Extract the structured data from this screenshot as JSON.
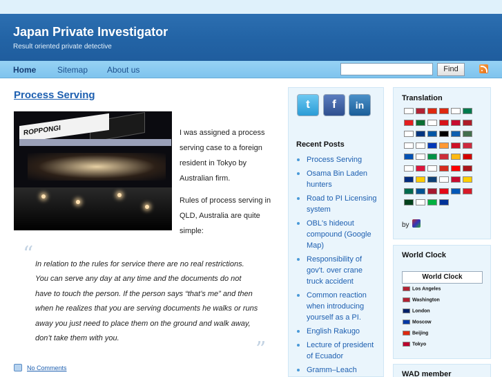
{
  "site": {
    "title": "Japan Private Investigator",
    "tagline": "Result oriented private detective"
  },
  "nav": {
    "items": [
      {
        "label": "Home",
        "active": true
      },
      {
        "label": "Sitemap",
        "active": false
      },
      {
        "label": "About us",
        "active": false
      }
    ],
    "search_placeholder": "",
    "search_button": "Find",
    "rss_icon": "rss-icon"
  },
  "post": {
    "title": "Process Serving",
    "image_sign": "ROPPONGI",
    "paragraphs": [
      "I was assigned a process",
      "serving case to a foreign",
      "resident in Tokyo by",
      "Australian firm.",
      "Rules of process serving in",
      "QLD, Australia are quite",
      "simple:"
    ],
    "quote_open": "“",
    "quote_close": "”",
    "quote_lines": [
      "In relation to the rules for service there are no real restrictions.",
      "You can serve any day at any time and the documents do not",
      "have to touch the person. If the person says “that’s me” and then",
      "when he realizes that you are serving documents he walks or runs",
      "away you just need to place them on the ground and walk away,",
      "don’t take them with you."
    ],
    "comments_link": "No Comments"
  },
  "social": [
    {
      "name": "twitter",
      "glyph": "t"
    },
    {
      "name": "facebook",
      "glyph": "f"
    },
    {
      "name": "linkedin",
      "glyph": "in"
    }
  ],
  "recent_posts": {
    "heading": "Recent Posts",
    "items": [
      "Process Serving",
      "Osama Bin Laden hunters",
      "Road to PI Licensing system",
      "OBL's hideout compound (Google Map)",
      "Responsibility of gov't. over crane truck accident",
      "Common reaction when introducing yourself as a PI.",
      "English Rakugo",
      "Lecture of president of Ecuador",
      "Gramm–Leach"
    ]
  },
  "translation": {
    "heading": "Translation",
    "by_label": "by",
    "flag_colors": [
      [
        "#ffffff",
        "#b22234",
        "#de2910",
        "#de2910",
        "#ffffff",
        "#007a4d"
      ],
      [
        "#e41e20",
        "#0a6e32",
        "#ffffff",
        "#d7141a",
        "#c60c30",
        "#ae1c28"
      ],
      [
        "#ffffff",
        "#003580",
        "#0055a4",
        "#000000",
        "#0d5eaf",
        "#436f4d"
      ],
      [
        "#ffffff",
        "#ffffff",
        "#0038b8",
        "#ff9933",
        "#ce1126",
        "#cd2a3e"
      ],
      [
        "#0052b4",
        "#ffffff",
        "#009246",
        "#cd2e3a",
        "#fdb913",
        "#d20000"
      ],
      [
        "#ffffff",
        "#dc143c",
        "#ffffff",
        "#d52b1e",
        "#ff0000",
        "#aa151b"
      ],
      [
        "#002b7f",
        "#fecb00",
        "#0c4076",
        "#ffffff",
        "#c60c30",
        "#ffce00"
      ],
      [
        "#006a4e",
        "#005293",
        "#a51931",
        "#e30a17",
        "#0057b7",
        "#d71a28"
      ],
      [
        "#01411c",
        "#ffffff",
        "#00b140",
        "#003399"
      ]
    ]
  },
  "world_clock": {
    "heading": "World Clock",
    "inner_title": "World Clock",
    "cities": [
      {
        "name": "Los Angeles",
        "flag": "#b22234"
      },
      {
        "name": "Washington",
        "flag": "#b22234"
      },
      {
        "name": "London",
        "flag": "#012169"
      },
      {
        "name": "Moscow",
        "flag": "#0039a6"
      },
      {
        "name": "Beijing",
        "flag": "#de2910"
      },
      {
        "name": "Tokyo",
        "flag": "#bc002d"
      }
    ]
  },
  "wad": {
    "heading": "WAD member"
  },
  "colors": {
    "header": "#2364a6",
    "nav": "#8ccaf2",
    "link": "#1d5fb0",
    "sidebar_bg": "#eaf5fc"
  }
}
